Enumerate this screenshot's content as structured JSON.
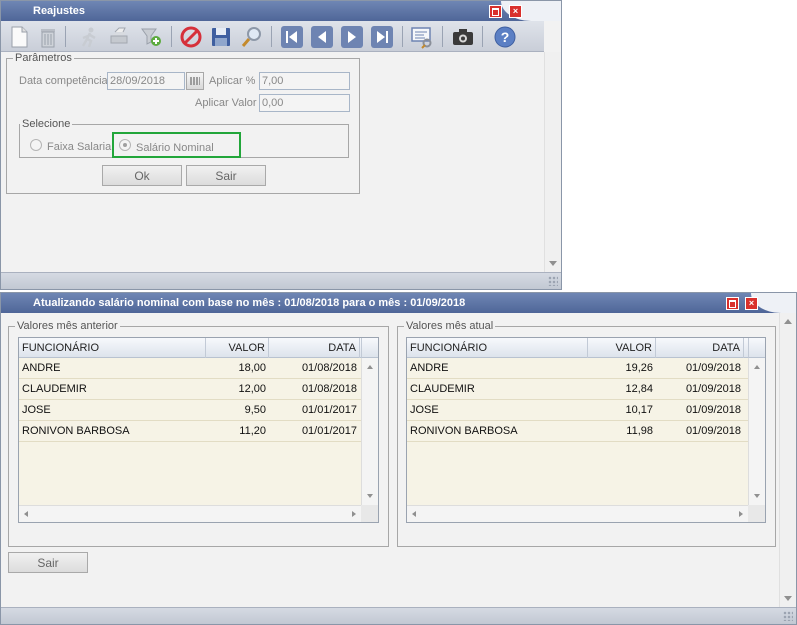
{
  "window_reajustes": {
    "title": "Reajustes",
    "toolbar_icons": [
      "new-document-icon",
      "trash-icon",
      "run-icon",
      "print-icon",
      "filter-add-icon",
      "cancel-icon",
      "save-icon",
      "search-icon",
      "first-record-icon",
      "previous-record-icon",
      "next-record-icon",
      "last-record-icon",
      "presentation-icon",
      "camera-icon",
      "help-icon"
    ],
    "parametros": {
      "legend": "Parâmetros",
      "data_competencia_label": "Data competência :",
      "data_competencia_value": "28/09/2018",
      "aplicar_pct_label": "Aplicar % :",
      "aplicar_pct_value": "7,00",
      "aplicar_valor_label": "Aplicar Valor :",
      "aplicar_valor_value": "0,00",
      "selecione": {
        "legend": "Selecione",
        "option1": "Faixa Salarial",
        "option2": "Salário Nominal",
        "selected": "Salário Nominal"
      },
      "ok_label": "Ok",
      "sair_label": "Sair"
    }
  },
  "window_atualizando": {
    "title": "Atualizando salário nominal com base no mês : 01/08/2018 para o mês : 01/09/2018",
    "anterior": {
      "legend": "Valores mês anterior",
      "headers": [
        "FUNCIONÁRIO",
        "VALOR",
        "DATA"
      ],
      "rows": [
        [
          "ANDRE",
          "18,00",
          "01/08/2018"
        ],
        [
          "CLAUDEMIR",
          "12,00",
          "01/08/2018"
        ],
        [
          "JOSE",
          "9,50",
          "01/01/2017"
        ],
        [
          "RONIVON BARBOSA",
          "11,20",
          "01/01/2017"
        ]
      ]
    },
    "atual": {
      "legend": "Valores mês atual",
      "headers": [
        "FUNCIONÁRIO",
        "VALOR",
        "DATA"
      ],
      "rows": [
        [
          "ANDRE",
          "19,26",
          "01/09/2018"
        ],
        [
          "CLAUDEMIR",
          "12,84",
          "01/09/2018"
        ],
        [
          "JOSE",
          "10,17",
          "01/09/2018"
        ],
        [
          "RONIVON BARBOSA",
          "11,98",
          "01/09/2018"
        ]
      ]
    },
    "sair_label": "Sair"
  },
  "colors": {
    "title_bar": "#5a71a3",
    "close_button": "#d9302c",
    "grid_row": "#f6f3e6",
    "selection_highlight": "#22a63a"
  }
}
